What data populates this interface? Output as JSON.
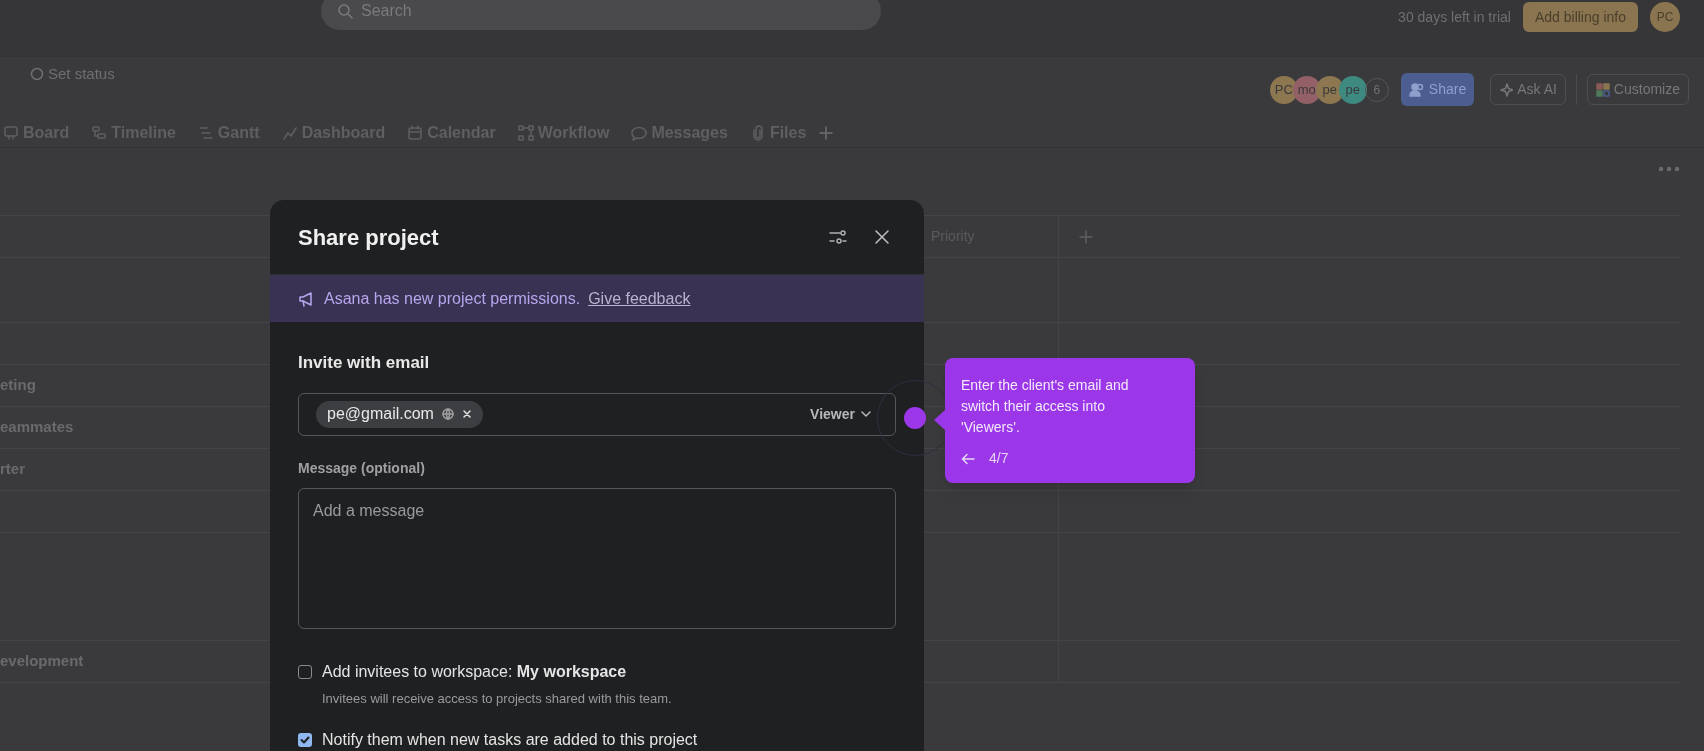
{
  "top_bar": {
    "search": {
      "placeholder": "Search"
    },
    "trial_text": "30 days left in trial",
    "billing_button": "Add billing info",
    "avatar": "PC"
  },
  "project_header": {
    "set_status": "Set status",
    "members": [
      {
        "initials": "PC",
        "color": "#8c7750"
      },
      {
        "initials": "mo",
        "color": "#946068"
      },
      {
        "initials": "pe",
        "color": "#8c7750"
      },
      {
        "initials": "pe",
        "color": "#3f8a80"
      }
    ],
    "member_count": "6",
    "share_button": "Share",
    "ask_ai_button": "Ask AI",
    "customize_button": "Customize"
  },
  "tabs": [
    {
      "label": "Board",
      "selected": false
    },
    {
      "label": "Timeline",
      "selected": false
    },
    {
      "label": "Gantt",
      "selected": false
    },
    {
      "label": "Dashboard",
      "selected": false
    },
    {
      "label": "Calendar",
      "selected": false
    },
    {
      "label": "Workflow",
      "selected": false
    },
    {
      "label": "Messages",
      "selected": false
    },
    {
      "label": "Files",
      "selected": false
    }
  ],
  "table": {
    "columns": [
      "Priority"
    ],
    "rows": [
      {
        "kind": "spacer"
      },
      {
        "kind": "task"
      },
      {
        "kind": "task",
        "label": "eting"
      },
      {
        "kind": "task",
        "label": "eammates"
      },
      {
        "kind": "task",
        "label": "rter"
      },
      {
        "kind": "task"
      },
      {
        "kind": "wide_spacer"
      },
      {
        "kind": "task",
        "label": "evelopment"
      }
    ]
  },
  "share_dialog": {
    "title": "Share project",
    "banner": {
      "text": "Asana has new project permissions.",
      "link": "Give feedback"
    },
    "invite_heading": "Invite with email",
    "invitee_chip": "pe@gmail.com",
    "role": "Viewer",
    "message_label": "Message (optional)",
    "message": {
      "placeholder": "Add a message"
    },
    "options": [
      {
        "label": "Add invitees to workspace: **My workspace**",
        "hint": "Invitees will receive access to projects shared with this team.",
        "checked": false
      },
      {
        "label": "Notify them when new tasks are added to this project",
        "checked": true
      }
    ]
  },
  "guide_tooltip": {
    "text": "Enter the client's email and switch their access into 'Viewers'.",
    "step": "4/7"
  }
}
